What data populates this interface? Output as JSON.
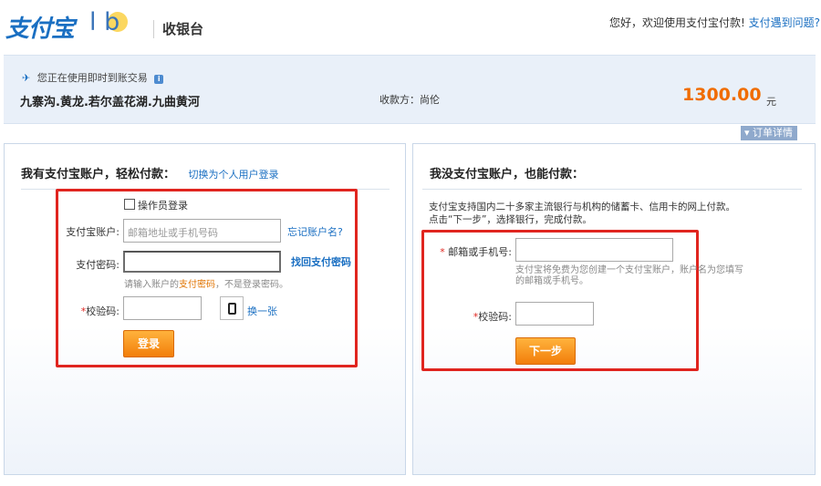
{
  "header": {
    "logo_alipay": "支付宝",
    "logo_lab": "l   b",
    "cashier_title": "收银台",
    "greeting": "您好，欢迎使用支付宝付款!",
    "help_link": "支付遇到问题?"
  },
  "order": {
    "type": "您正在使用即时到账交易",
    "name": "九寨沟.黄龙.若尔盖花湖.九曲黄河",
    "payee_label": "收款方：尚伦",
    "amount": "1300.00",
    "currency": "元",
    "detail_tab": "订单详情"
  },
  "left_panel": {
    "title": "我有支付宝账户，轻松付款：",
    "switch_link": "切换为个人用户登录",
    "operator_login": "操作员登录",
    "account_label": "支付宝账户:",
    "account_placeholder": "邮箱地址或手机号码",
    "forgot_account": "忘记账户名?",
    "password_label": "支付密码:",
    "password_value": "",
    "retrieve_password": "找回支付密码",
    "hint_prefix": "请输入账户的",
    "hint_highlight": "支付密码",
    "hint_suffix": "，不是登录密码。",
    "captcha_required": "*",
    "captcha_label": "校验码:",
    "captcha_refresh": "换一张",
    "login_button": "登录"
  },
  "right_panel": {
    "title": "我没支付宝账户，也能付款：",
    "intro_line1": "支付宝支持国内二十多家主流银行与机构的储蓄卡、信用卡的网上付款。",
    "intro_line2": "点击“下一步”，选择银行，完成付款。",
    "email_required": "*",
    "email_label": "邮箱或手机号:",
    "email_hint": "支付宝将免费为您创建一个支付宝账户，账户名为您填写的邮箱或手机号。",
    "captcha_required": "*",
    "captcha_label": "校验码:",
    "next_button": "下一步"
  },
  "colors": {
    "brand_blue": "#1a6fc2",
    "amount_orange": "#f06c00",
    "highlight_red": "#e0251f",
    "button_orange": "#f27e0a"
  }
}
